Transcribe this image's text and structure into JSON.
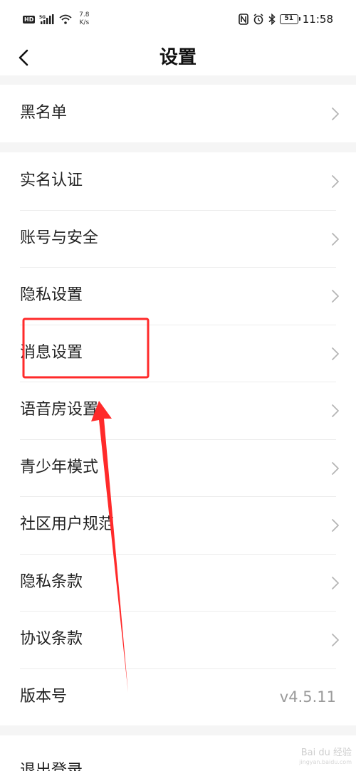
{
  "status_bar": {
    "hd_label": "HD",
    "signal_label": "5G",
    "speed_value": "7.8",
    "speed_unit": "K/s",
    "battery": "51",
    "time": "11:58"
  },
  "header": {
    "title": "设置"
  },
  "groups": {
    "blacklist": {
      "label": "黑名单"
    },
    "main": {
      "items": [
        {
          "label": "实名认证"
        },
        {
          "label": "账号与安全"
        },
        {
          "label": "隐私设置"
        },
        {
          "label": "消息设置"
        },
        {
          "label": "语音房设置"
        },
        {
          "label": "青少年模式"
        },
        {
          "label": "社区用户规范"
        },
        {
          "label": "隐私条款"
        },
        {
          "label": "协议条款"
        }
      ],
      "version": {
        "label": "版本号",
        "value": "v4.5.11"
      }
    },
    "logout": {
      "label": "退出登录"
    }
  },
  "annotation": {
    "color": "#ff2a2a"
  },
  "watermark": {
    "brand": "Bai du 经验",
    "domain": "jingyan.baidu.com"
  },
  "colors": {
    "background": "#f5f5f5",
    "surface": "#ffffff",
    "text_primary": "#222222",
    "text_secondary": "#9a9a9a",
    "chevron": "#b5b5b5"
  }
}
